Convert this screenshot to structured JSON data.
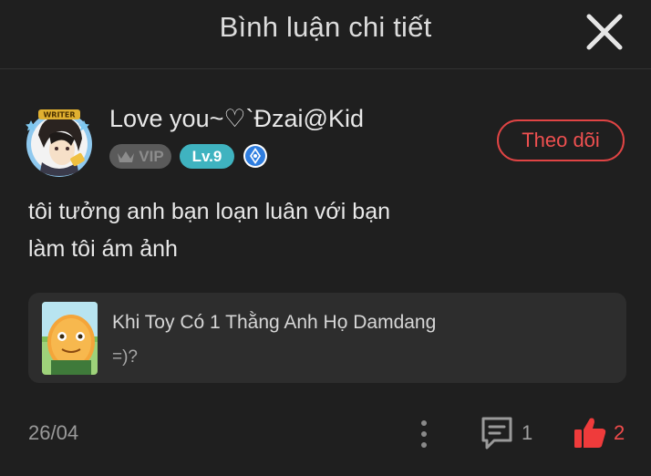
{
  "header": {
    "title": "Bình luận chi tiết"
  },
  "user": {
    "name": "Love you~♡`Đzai@Kid",
    "vip_label": "VIP",
    "level_label": "Lv.9",
    "follow_label": "Theo dõi"
  },
  "comment": {
    "line1": "tôi tưởng anh bạn loạn luân với bạn",
    "line2": "làm tôi ám ảnh"
  },
  "reference": {
    "title": "Khi Toy Có 1 Thằng Anh Họ Damdang",
    "subtitle": "=)?"
  },
  "footer": {
    "date": "26/04",
    "reply_count": "1",
    "like_count": "2"
  },
  "colors": {
    "background": "#1f1f1f",
    "accent_red": "#ef4b4b",
    "level_badge": "#3fb3c0",
    "vip_badge": "#5a5a5a",
    "card": "#2d2d2d"
  },
  "icons": {
    "close": "close-icon",
    "vip": "crown-icon",
    "rank": "rank-badge-icon",
    "more": "more-vertical-icon",
    "reply": "comment-icon",
    "like": "thumbs-up-icon"
  }
}
